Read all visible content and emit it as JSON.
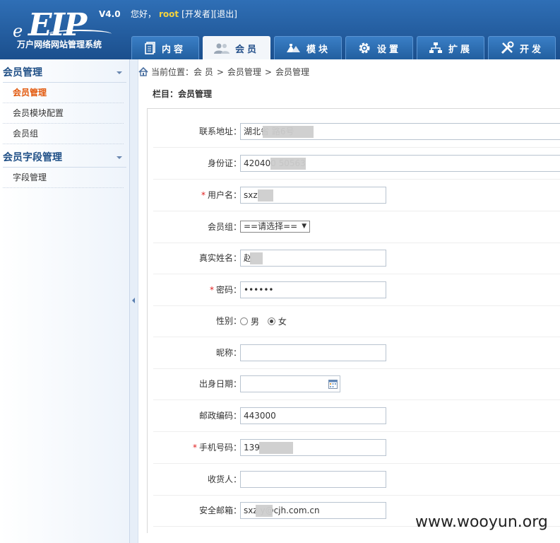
{
  "logo": {
    "brand": "EIP",
    "version": "V4.0",
    "subtitle": "万户网络网站管理系统"
  },
  "userbar": {
    "greeting": "您好，",
    "username": "root",
    "role_link": "[开发者]",
    "logout_link": "[退出]"
  },
  "tabs": [
    {
      "label": "内容",
      "icon": "document-icon"
    },
    {
      "label": "会员",
      "icon": "users-icon",
      "active": true
    },
    {
      "label": "模块",
      "icon": "modules-icon"
    },
    {
      "label": "设置",
      "icon": "gear-icon"
    },
    {
      "label": "扩展",
      "icon": "sitemap-icon"
    },
    {
      "label": "开发",
      "icon": "tools-icon"
    }
  ],
  "sidebar": {
    "groups": [
      {
        "title": "会员管理",
        "items": [
          "会员管理",
          "会员模块配置",
          "会员组"
        ]
      },
      {
        "title": "会员字段管理",
        "items": [
          "字段管理"
        ]
      }
    ],
    "active_item": "会员管理"
  },
  "breadcrumb": {
    "prefix": "当前位置：",
    "items": [
      "会 员",
      "会员管理",
      "会员管理"
    ],
    "separator": ">"
  },
  "column_title": "栏目：会员管理",
  "form": {
    "address": {
      "label": "联系地址：",
      "value": "湖北省              路6号"
    },
    "id_card": {
      "label": "身份证：",
      "value": "420400              50563"
    },
    "username": {
      "label": "用户名：",
      "value": "sxzl",
      "required": "*"
    },
    "member_group": {
      "label": "会员组：",
      "selected": "==请选择=="
    },
    "real_name": {
      "label": "真实姓名：",
      "value": "赵"
    },
    "password": {
      "label": "密码：",
      "value": "••••••",
      "required": "*"
    },
    "gender": {
      "label": "性别：",
      "options": [
        "男",
        "女"
      ],
      "selected": "女"
    },
    "nickname": {
      "label": "昵称：",
      "value": ""
    },
    "birthdate": {
      "label": "出身日期：",
      "value": ""
    },
    "postcode": {
      "label": "邮政编码：",
      "value": "443000"
    },
    "mobile": {
      "label": "手机号码：",
      "value": "139",
      "required": "*"
    },
    "recipient": {
      "label": "收货人：",
      "value": ""
    },
    "email": {
      "label": "安全邮箱：",
      "value": "sxz      y@cjh.com.cn"
    }
  },
  "watermark": "www.wooyun.org",
  "colors": {
    "header": "#2f6fb6",
    "active_link": "#e2580c",
    "required": "#e02020",
    "username": "#f5d33d"
  }
}
